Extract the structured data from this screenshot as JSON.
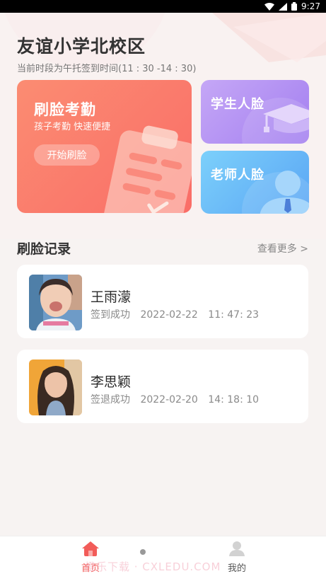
{
  "status_bar": {
    "time": "9:27"
  },
  "header": {
    "school_name": "友谊小学北校区",
    "time_tip": "当前时段为午托签到时间(11 : 30 -14 : 30)"
  },
  "cards": {
    "main": {
      "title": "刷脸考勤",
      "subtitle": "孩子考勤  快速便捷",
      "button": "开始刷脸"
    },
    "student": {
      "label": "学生人脸"
    },
    "teacher": {
      "label": "老师人脸"
    }
  },
  "records_section": {
    "title": "刷脸记录",
    "more": "查看更多 >",
    "items": [
      {
        "name": "王雨濛",
        "status": "签到成功",
        "date": "2022-02-22",
        "time": "11: 47: 23"
      },
      {
        "name": "李思颖",
        "status": "签退成功",
        "date": "2022-02-20",
        "time": "14: 18: 10"
      }
    ]
  },
  "tabbar": {
    "home": "首页",
    "mine": "我的"
  },
  "watermark": "橙乐下载 · CXLEDU.COM",
  "colors": {
    "accent": "#f25c59",
    "main_card": "#fa7a6c",
    "student_card": "#b594f3",
    "teacher_card": "#6bbaf8"
  }
}
